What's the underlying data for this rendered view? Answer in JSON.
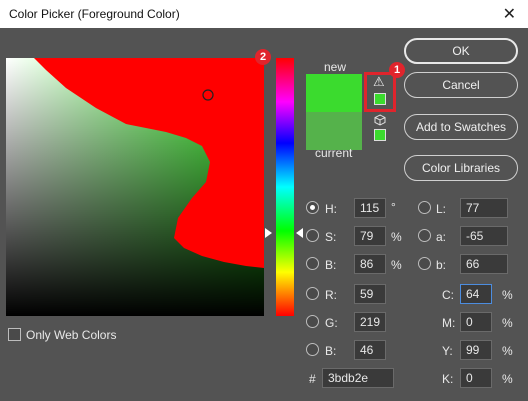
{
  "window": {
    "title": "Color Picker (Foreground Color)",
    "close_glyph": "✕"
  },
  "annotations": {
    "badge_1": "1",
    "badge_2": "2"
  },
  "swatches": {
    "new_label": "new",
    "current_label": "current",
    "new_color": "#3bdb2e",
    "current_color": "#55b24b",
    "warning_glyph": "⚠"
  },
  "buttons": {
    "ok": "OK",
    "cancel": "Cancel",
    "add_to_swatches": "Add to Swatches",
    "color_libraries": "Color Libraries"
  },
  "hsb": {
    "h": {
      "label": "H:",
      "value": "115",
      "unit": "°"
    },
    "s": {
      "label": "S:",
      "value": "79",
      "unit": "%"
    },
    "b": {
      "label": "B:",
      "value": "86",
      "unit": "%"
    }
  },
  "rgb": {
    "r": {
      "label": "R:",
      "value": "59"
    },
    "g": {
      "label": "G:",
      "value": "219"
    },
    "b": {
      "label": "B:",
      "value": "46"
    }
  },
  "lab": {
    "l": {
      "label": "L:",
      "value": "77"
    },
    "a": {
      "label": "a:",
      "value": "-65"
    },
    "b": {
      "label": "b:",
      "value": "66"
    }
  },
  "cmyk": {
    "c": {
      "label": "C:",
      "value": "64",
      "unit": "%"
    },
    "m": {
      "label": "M:",
      "value": "0",
      "unit": "%"
    },
    "y": {
      "label": "Y:",
      "value": "99",
      "unit": "%"
    },
    "k": {
      "label": "K:",
      "value": "0",
      "unit": "%"
    }
  },
  "hex": {
    "label": "#",
    "value": "3bdb2e"
  },
  "options": {
    "only_web_colors": "Only Web Colors"
  }
}
